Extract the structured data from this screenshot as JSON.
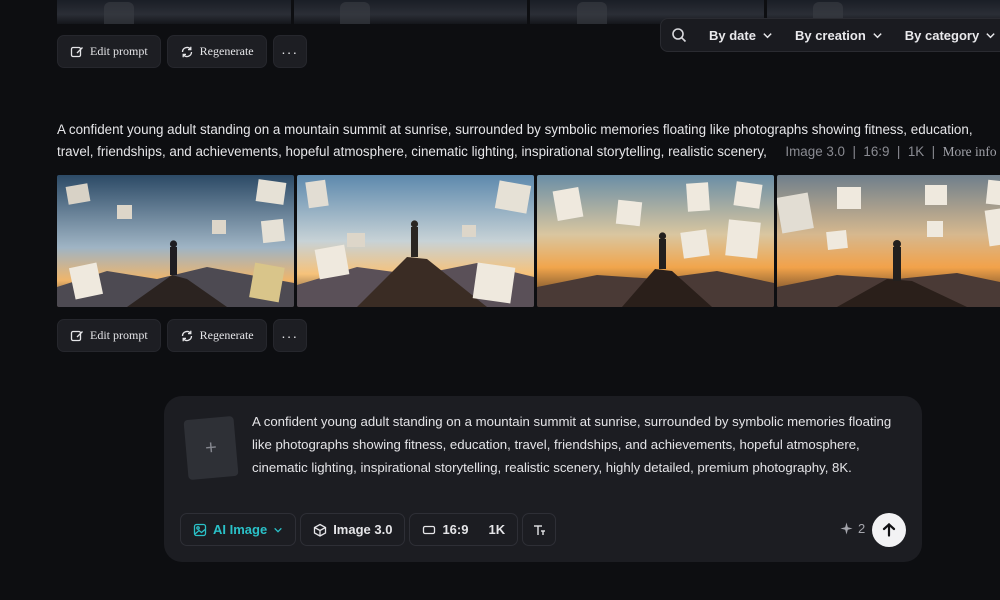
{
  "filters": {
    "by_date": "By date",
    "by_creation": "By creation",
    "by_category": "By category"
  },
  "actions": {
    "edit_prompt": "Edit prompt",
    "regenerate": "Regenerate",
    "more": "···"
  },
  "result": {
    "prompt_line1": "A confident young adult standing on a mountain summit at sunrise, surrounded by symbolic memories floating like photographs showing fitness, education,",
    "prompt_line2": "travel, friendships, and achievements, hopeful atmosphere, cinematic lighting, inspirational storytelling, realistic scenery,",
    "model": "Image 3.0",
    "ratio": "16:9",
    "resolution": "1K",
    "more_info": "More info"
  },
  "composer": {
    "upload_plus": "+",
    "prompt": "A confident young adult standing on a mountain summit at sunrise, surrounded by symbolic memories floating like photographs showing fitness, education, travel, friendships, and achievements, hopeful atmosphere, cinematic lighting, inspirational storytelling, realistic scenery, highly detailed, premium photography, 8K.",
    "mode": "AI Image",
    "model": "Image 3.0",
    "ratio": "16:9",
    "resolution": "1K",
    "credits": "2"
  },
  "colors": {
    "accent": "#2ac1c8",
    "background": "#0d0e11",
    "panel": "#1c1d22"
  }
}
